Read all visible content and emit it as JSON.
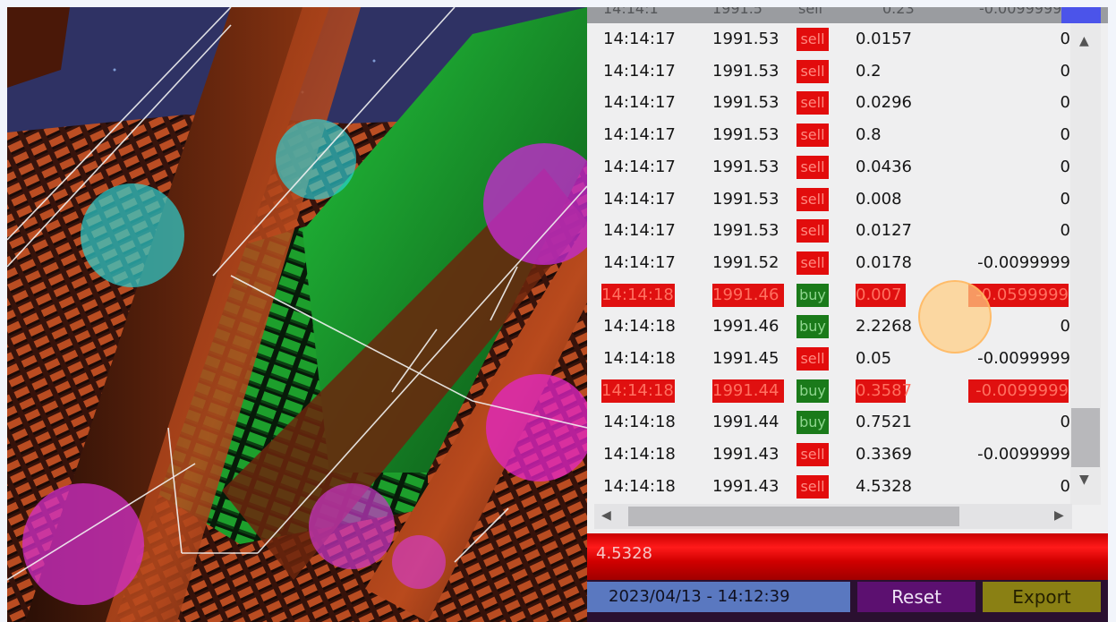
{
  "trades": {
    "header": [
      "14:14:1",
      "1991.5",
      "sell",
      "0.23",
      "-0.0099999"
    ],
    "rows": [
      {
        "time": "14:14:17",
        "price": "1991.53",
        "side": "sell",
        "amount": "0.0157",
        "change": "0",
        "highlight": false
      },
      {
        "time": "14:14:17",
        "price": "1991.53",
        "side": "sell",
        "amount": "0.2",
        "change": "0",
        "highlight": false
      },
      {
        "time": "14:14:17",
        "price": "1991.53",
        "side": "sell",
        "amount": "0.0296",
        "change": "0",
        "highlight": false
      },
      {
        "time": "14:14:17",
        "price": "1991.53",
        "side": "sell",
        "amount": "0.8",
        "change": "0",
        "highlight": false
      },
      {
        "time": "14:14:17",
        "price": "1991.53",
        "side": "sell",
        "amount": "0.0436",
        "change": "0",
        "highlight": false
      },
      {
        "time": "14:14:17",
        "price": "1991.53",
        "side": "sell",
        "amount": "0.008",
        "change": "0",
        "highlight": false
      },
      {
        "time": "14:14:17",
        "price": "1991.53",
        "side": "sell",
        "amount": "0.0127",
        "change": "0",
        "highlight": false
      },
      {
        "time": "14:14:17",
        "price": "1991.52",
        "side": "sell",
        "amount": "0.0178",
        "change": "-0.0099999",
        "highlight": false
      },
      {
        "time": "14:14:18",
        "price": "1991.46",
        "side": "buy",
        "amount": "0.007",
        "change": "-0.0599999",
        "highlight": true
      },
      {
        "time": "14:14:18",
        "price": "1991.46",
        "side": "buy",
        "amount": "2.2268",
        "change": "0",
        "highlight": false
      },
      {
        "time": "14:14:18",
        "price": "1991.45",
        "side": "sell",
        "amount": "0.05",
        "change": "-0.0099999",
        "highlight": false
      },
      {
        "time": "14:14:18",
        "price": "1991.44",
        "side": "buy",
        "amount": "0.3587",
        "change": "-0.0099999",
        "highlight": true
      },
      {
        "time": "14:14:18",
        "price": "1991.44",
        "side": "buy",
        "amount": "0.7521",
        "change": "0",
        "highlight": false
      },
      {
        "time": "14:14:18",
        "price": "1991.43",
        "side": "sell",
        "amount": "0.3369",
        "change": "-0.0099999",
        "highlight": false
      },
      {
        "time": "14:14:18",
        "price": "1991.43",
        "side": "sell",
        "amount": "4.5328",
        "change": "0",
        "highlight": false
      }
    ]
  },
  "selected_amount": "4.5328",
  "timestamp": "2023/04/13 - 14:12:39",
  "buttons": {
    "reset": "Reset",
    "export": "Export"
  },
  "colors": {
    "sell": "#e20c0c",
    "buy": "#1a7a1a",
    "reset": "#5c1070",
    "export": "#8a8014",
    "date": "#5a78c0"
  }
}
